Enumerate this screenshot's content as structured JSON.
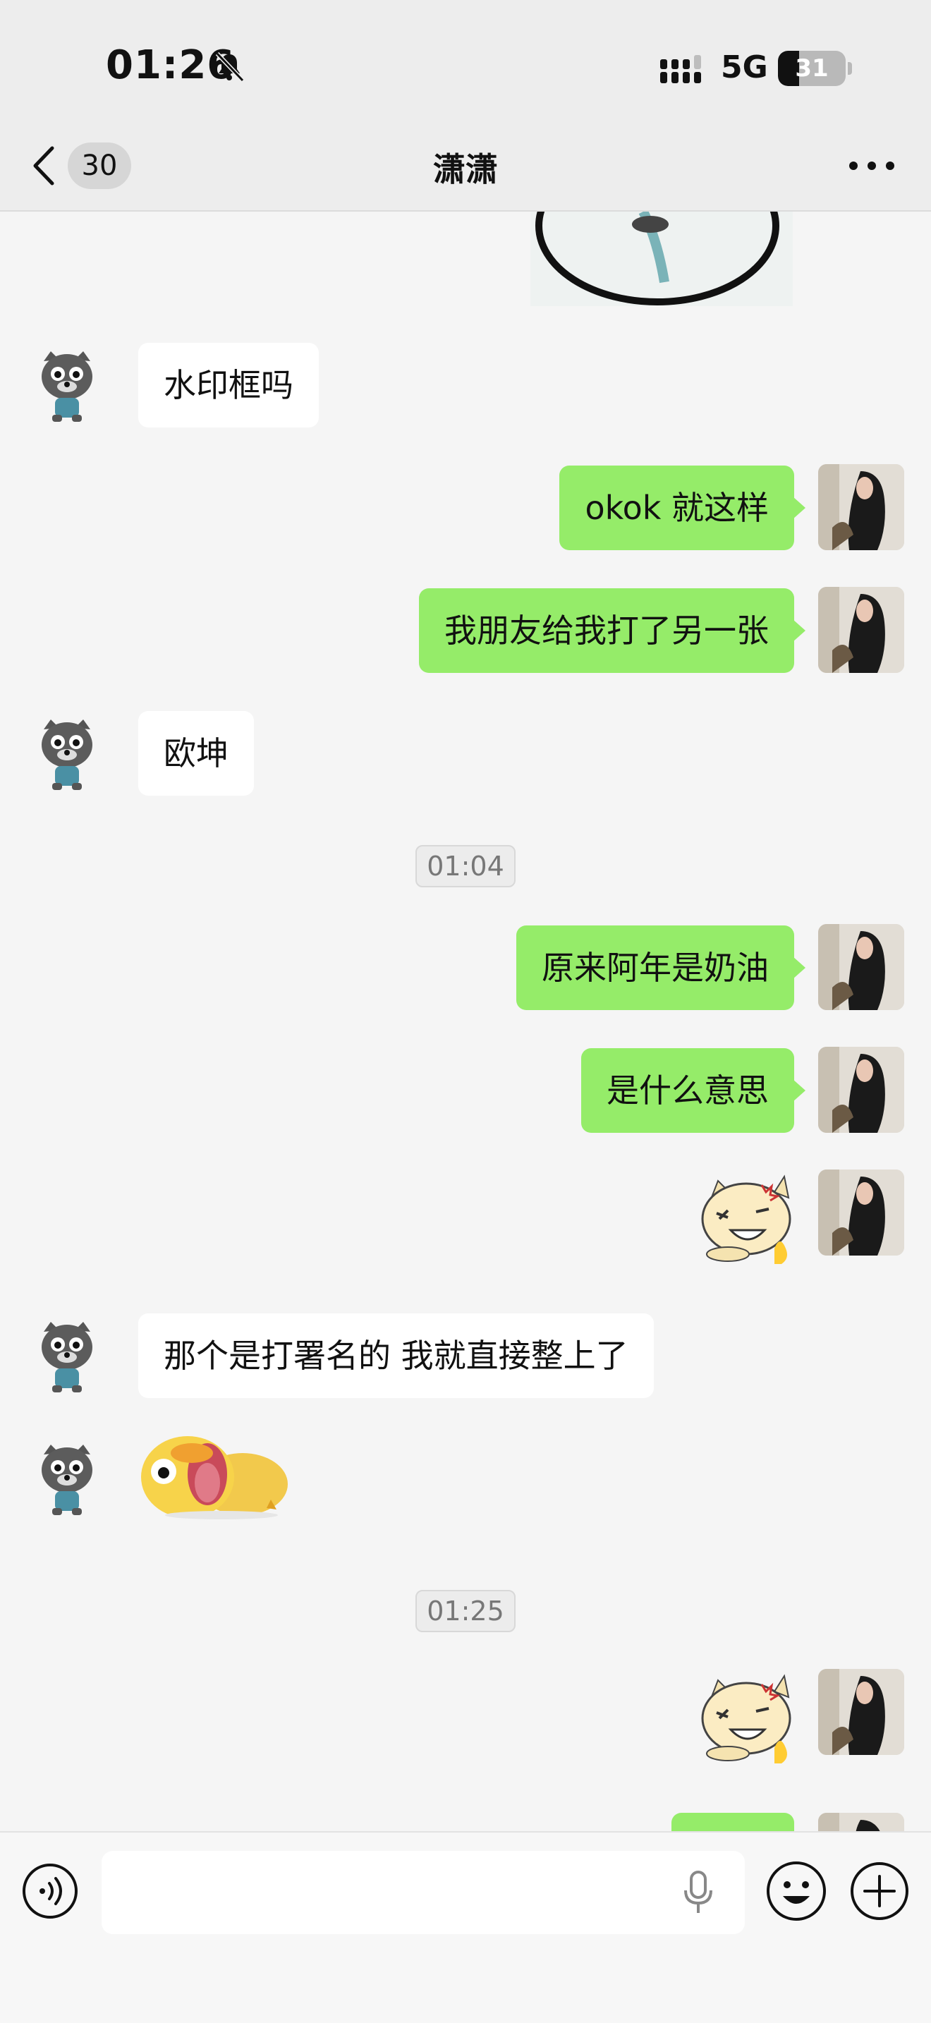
{
  "status_bar": {
    "time": "01:26",
    "network": "5G",
    "battery": "31",
    "battery_level": 0.31
  },
  "nav": {
    "back_count": "30",
    "title": "潇潇",
    "more_icon": "more-dots-icon"
  },
  "messages": [
    {
      "type": "image-fragment",
      "side": "incoming-image"
    },
    {
      "type": "text",
      "side": "in",
      "text": "水印框吗"
    },
    {
      "type": "text",
      "side": "out",
      "text": "okok 就这样"
    },
    {
      "type": "text",
      "side": "out",
      "text": "我朋友给我打了另一张"
    },
    {
      "type": "text",
      "side": "in",
      "text": "欧坤"
    },
    {
      "type": "time",
      "text": "01:04"
    },
    {
      "type": "text",
      "side": "out",
      "text": "原来阿年是奶油"
    },
    {
      "type": "text",
      "side": "out",
      "text": "是什么意思"
    },
    {
      "type": "sticker",
      "side": "out",
      "sticker": "angry-cat-sticker"
    },
    {
      "type": "text",
      "side": "in",
      "text": "那个是打署名的 我就直接整上了"
    },
    {
      "type": "sticker",
      "side": "in",
      "sticker": "yellow-duck-sticker"
    },
    {
      "type": "time",
      "text": "01:25"
    },
    {
      "type": "sticker",
      "side": "out",
      "sticker": "angry-cat-sticker"
    }
  ],
  "input_bar": {
    "voice_icon": "voice-icon",
    "mic_icon": "mic-icon",
    "emoji_icon": "emoji-icon",
    "plus_icon": "plus-icon"
  },
  "colors": {
    "outgoing_bubble": "#95ec69",
    "incoming_bubble": "#ffffff",
    "chat_background": "#f5f5f5",
    "bar_background": "#ededed"
  }
}
